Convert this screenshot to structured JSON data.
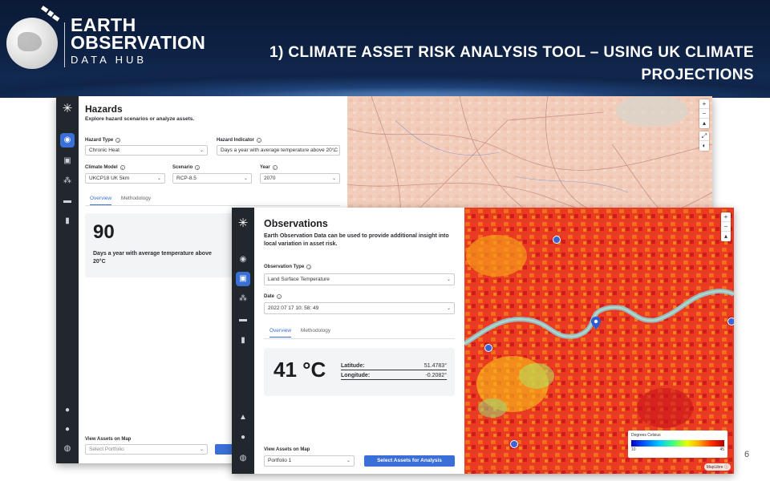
{
  "header": {
    "logo_line1": "EARTH",
    "logo_line2": "OBSERVATION",
    "logo_line3": "DATA HUB",
    "slide_title": "1) CLIMATE ASSET RISK ANALYSIS TOOL – USING UK CLIMATE PROJECTIONS"
  },
  "page_number": "6",
  "hazards": {
    "title": "Hazards",
    "subtitle": "Explore hazard scenarios or analyze assets.",
    "hazard_type_label": "Hazard Type",
    "hazard_type_value": "Chronic Heat",
    "hazard_indicator_label": "Hazard Indicator",
    "hazard_indicator_value": "Days a year with average temperature above 20°C",
    "climate_model_label": "Climate Model",
    "climate_model_value": "UKCP18 UK 5km",
    "scenario_label": "Scenario",
    "scenario_value": "RCP-8.5",
    "year_label": "Year",
    "year_value": "2070",
    "tabs": [
      "Overview",
      "Methodology"
    ],
    "big_value": "90",
    "big_caption": "Days a year with average temperature above 20°C",
    "view_assets_label": "View Assets on Map",
    "portfolio_placeholder": "Select Portfolio"
  },
  "observations": {
    "title": "Observations",
    "subtitle": "Earth Observation Data can be used to provide additional insight into local variation in asset risk.",
    "obs_type_label": "Observation Type",
    "obs_type_value": "Land Surface Temperature",
    "date_label": "Date",
    "date_value": "2022 07 17 10: 58: 49",
    "tabs": [
      "Overview",
      "Methodology"
    ],
    "temperature": "41 °C",
    "latitude_label": "Latitude:",
    "latitude_value": "51.4783°",
    "longitude_label": "Longitude:",
    "longitude_value": "-0.2082°",
    "view_assets_label": "View Assets on Map",
    "portfolio_value": "Portfolio 1",
    "select_assets_button": "Select Assets for Analysis",
    "legend_title": "Degrees Celsius",
    "legend_min": "10",
    "legend_max": "45",
    "attribution": "MapLibre"
  }
}
